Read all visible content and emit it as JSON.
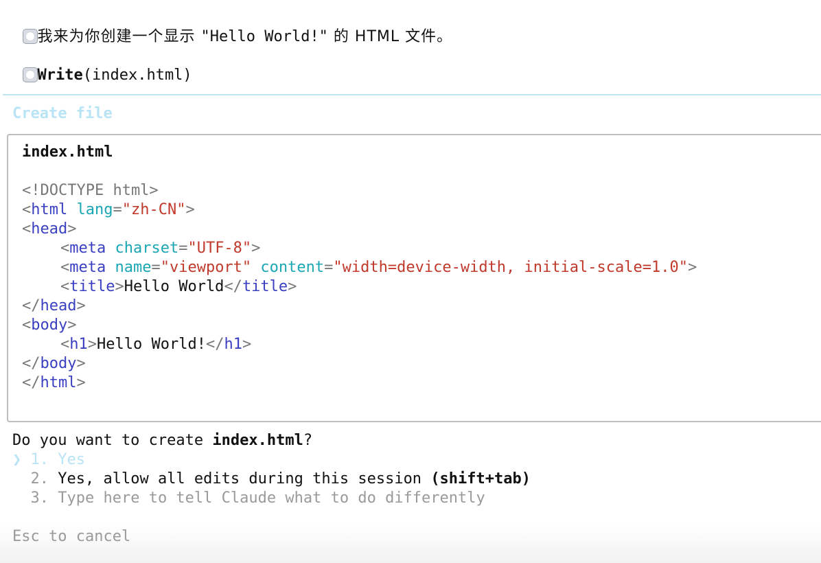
{
  "message": {
    "prefix": "我来为你创建一个显示 ",
    "quoted": "\"Hello World!\"",
    "suffix": " 的 HTML 文件。"
  },
  "tool_call": {
    "name": "Write",
    "args": "(index.html)"
  },
  "dialog": {
    "title": "Create file",
    "filename": "index.html",
    "code": {
      "doctype": "<!DOCTYPE html>",
      "html_open_lt": "<",
      "html_tag": "html",
      "html_attr": "lang",
      "html_eq": "=",
      "html_value": "\"zh-CN\"",
      "gt": ">",
      "head_tag": "head",
      "meta_tag": "meta",
      "charset_attr": "charset",
      "charset_value": "\"UTF-8\"",
      "name_attr": "name",
      "name_value": "\"viewport\"",
      "content_attr": "content",
      "content_value": "\"width=device-width, initial-scale=1.0\"",
      "title_tag": "title",
      "title_text": "Hello World",
      "body_tag": "body",
      "h1_tag": "h1",
      "h1_text": "Hello World!",
      "close_lt": "</"
    },
    "question_prefix": "Do you want to create ",
    "question_file": "index.html",
    "question_suffix": "?",
    "options": [
      {
        "marker": "❯",
        "number": "1.",
        "label": "Yes"
      },
      {
        "number": "2.",
        "label": "Yes, allow all edits during this session ",
        "hint": "(shift+tab)"
      },
      {
        "number": "3.",
        "label": "Type here to tell Claude what to do differently"
      }
    ],
    "cancel_hint": "Esc to cancel"
  }
}
